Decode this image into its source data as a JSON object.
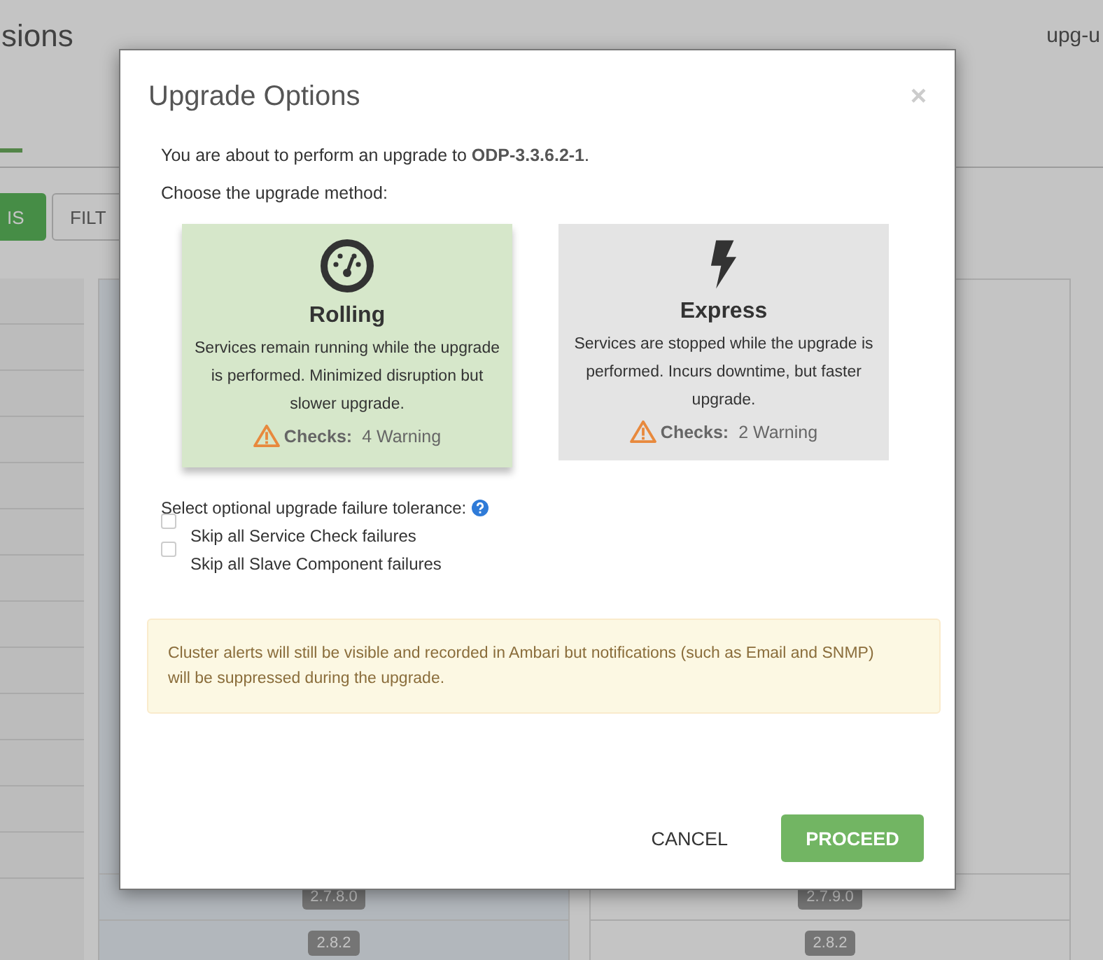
{
  "background": {
    "page_title": "sions",
    "user": "upg-u",
    "buttons": [
      {
        "label": "IS",
        "kind": "primary"
      },
      {
        "label": "FILT",
        "kind": "default"
      }
    ],
    "table_rows": [
      [
        "2.7.8.0",
        "2.7.9.0"
      ],
      [
        "2.8.2",
        "2.8.2"
      ]
    ]
  },
  "dialog": {
    "title": "Upgrade Options",
    "close": "×",
    "intro": "You are about to perform an upgrade to **ODP-3.3.6.2-1**.",
    "method_prompt": "Choose the upgrade method:",
    "methods": [
      {
        "kind": "rolling",
        "name": "Rolling",
        "description": "Services remain running while the upgrade is performed. Minimized disruption but slower upgrade.",
        "checks_label": "Checks:",
        "checks_value": "4 Warning",
        "selected": true
      },
      {
        "kind": "express",
        "name": "Express",
        "description": "Services are stopped while the upgrade is performed. Incurs downtime, but faster upgrade.",
        "checks_label": "Checks:",
        "checks_value": "2 Warning",
        "selected": false
      }
    ],
    "tolerance_label": "Select optional upgrade failure tolerance:",
    "tolerance_options": [
      {
        "label": "Skip all Service Check failures",
        "checked": false
      },
      {
        "label": "Skip all Slave Component failures",
        "checked": false
      }
    ],
    "alert": "Cluster alerts will still be visible and recorded in Ambari but notifications (such as Email and SNMP) will be suppressed during the upgrade.",
    "buttons": [
      {
        "label": "CANCEL",
        "kind": "link"
      },
      {
        "label": "PROCEED",
        "kind": "primary"
      }
    ]
  }
}
